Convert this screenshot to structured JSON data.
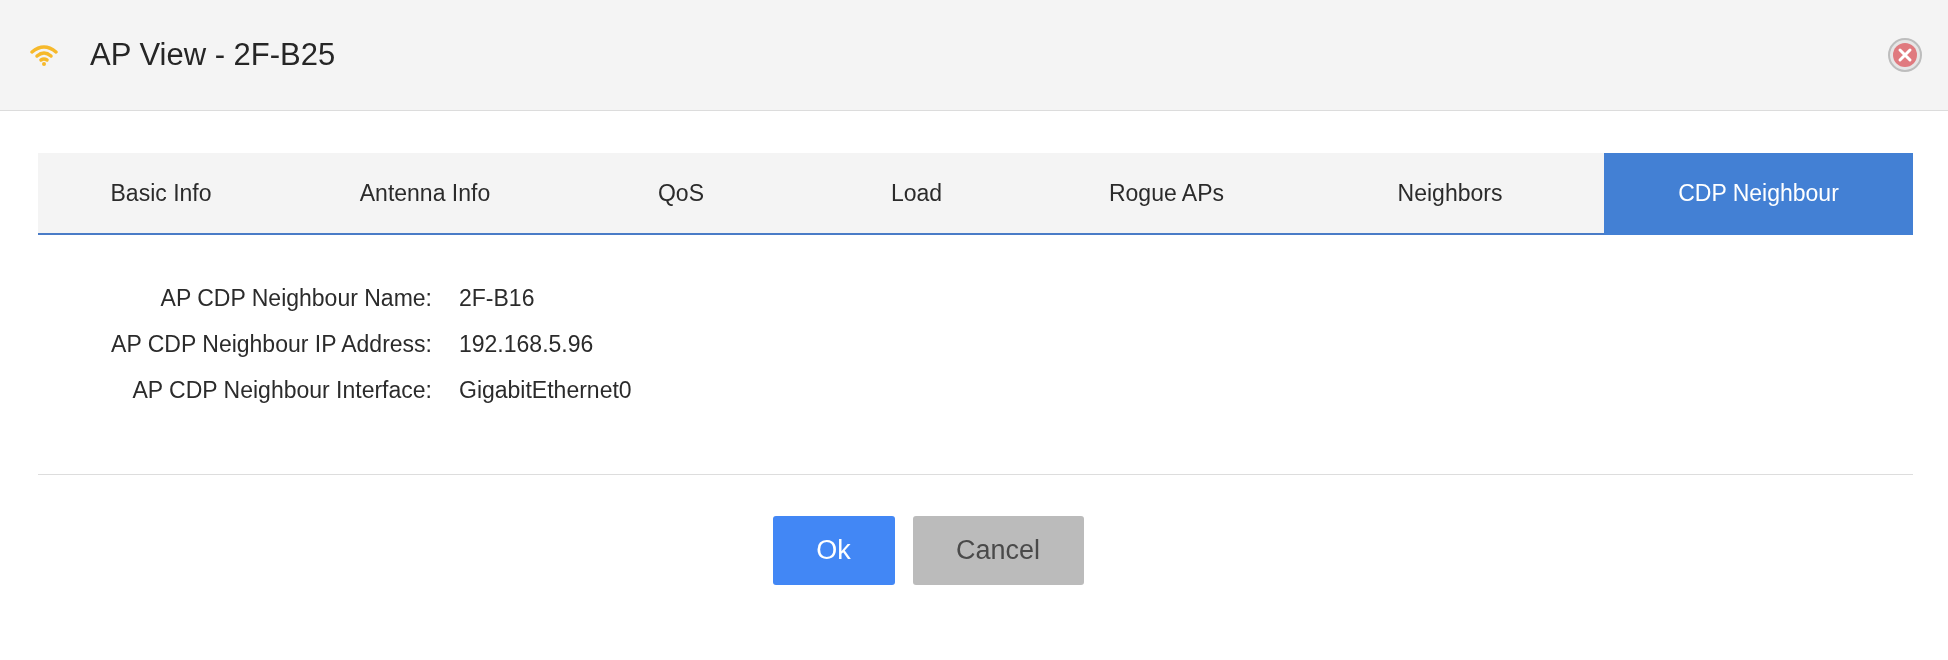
{
  "window": {
    "title": "AP View - 2F-B25"
  },
  "tabs": [
    {
      "label": "Basic Info",
      "selected": false
    },
    {
      "label": "Antenna Info",
      "selected": false
    },
    {
      "label": "QoS",
      "selected": false
    },
    {
      "label": "Load",
      "selected": false
    },
    {
      "label": "Rogue APs",
      "selected": false
    },
    {
      "label": "Neighbors",
      "selected": false
    },
    {
      "label": "CDP Neighbour",
      "selected": true
    }
  ],
  "fields": [
    {
      "label": "AP CDP Neighbour Name:",
      "value": "2F-B16"
    },
    {
      "label": "AP CDP Neighbour IP Address:",
      "value": "192.168.5.96"
    },
    {
      "label": "AP CDP Neighbour Interface:",
      "value": "GigabitEthernet0"
    }
  ],
  "buttons": [
    {
      "label": "Ok",
      "kind": "primary"
    },
    {
      "label": "Cancel",
      "kind": "secondary"
    }
  ]
}
